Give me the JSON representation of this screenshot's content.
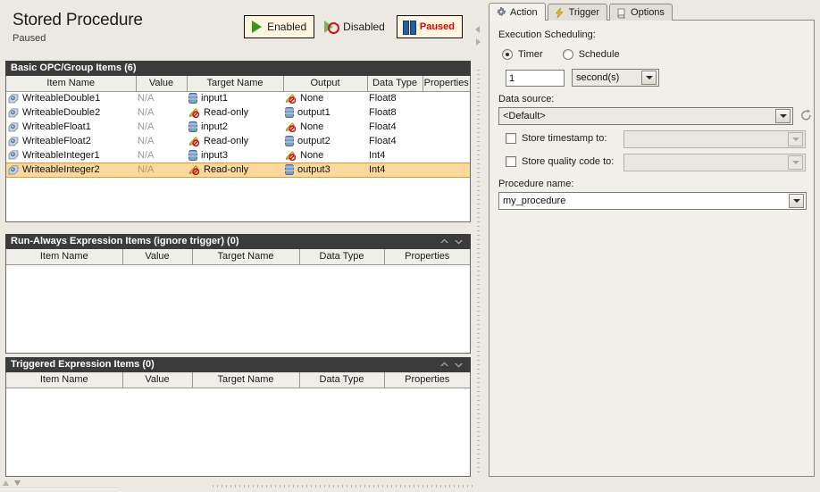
{
  "header": {
    "title": "Stored Procedure",
    "subtitle": "Paused",
    "buttons": [
      {
        "label": "Enabled",
        "icon": "play-icon",
        "framed": true
      },
      {
        "label": "Disabled",
        "icon": "play-disabled-icon",
        "framed": false
      },
      {
        "label": "Paused",
        "icon": "pause-icon",
        "framed": true
      }
    ]
  },
  "panels": {
    "basic": {
      "title": "Basic OPC/Group Items (6)",
      "columns": [
        "Item Name",
        "Value",
        "Target Name",
        "Output",
        "Data Type",
        "Properties"
      ],
      "rows": [
        {
          "name": "WriteableDouble1",
          "value": "N/A",
          "target": "input1",
          "target_icon": "database-icon",
          "output": "None",
          "output_icon": "read-only-icon",
          "datatype": "Float8",
          "properties": "",
          "selected": false
        },
        {
          "name": "WriteableDouble2",
          "value": "N/A",
          "target": "Read-only",
          "target_icon": "read-only-icon",
          "output": "output1",
          "output_icon": "database-icon",
          "datatype": "Float8",
          "properties": "",
          "selected": false
        },
        {
          "name": "WriteableFloat1",
          "value": "N/A",
          "target": "input2",
          "target_icon": "database-icon",
          "output": "None",
          "output_icon": "read-only-icon",
          "datatype": "Float4",
          "properties": "",
          "selected": false
        },
        {
          "name": "WriteableFloat2",
          "value": "N/A",
          "target": "Read-only",
          "target_icon": "read-only-icon",
          "output": "output2",
          "output_icon": "database-icon",
          "datatype": "Float4",
          "properties": "",
          "selected": false
        },
        {
          "name": "WriteableInteger1",
          "value": "N/A",
          "target": "input3",
          "target_icon": "database-icon",
          "output": "None",
          "output_icon": "read-only-icon",
          "datatype": "Int4",
          "properties": "",
          "selected": false
        },
        {
          "name": "WriteableInteger2",
          "value": "N/A",
          "target": "Read-only",
          "target_icon": "read-only-icon",
          "output": "output3",
          "output_icon": "database-icon",
          "datatype": "Int4",
          "properties": "",
          "selected": true
        }
      ]
    },
    "run_always": {
      "title": "Run-Always Expression Items (ignore trigger) (0)",
      "columns": [
        "Item Name",
        "Value",
        "Target Name",
        "Data Type",
        "Properties"
      ],
      "rows": []
    },
    "triggered": {
      "title": "Triggered Expression Items (0)",
      "columns": [
        "Item Name",
        "Value",
        "Target Name",
        "Data Type",
        "Properties"
      ],
      "rows": []
    }
  },
  "right": {
    "tabs": [
      {
        "label": "Action",
        "icon": "gear-icon",
        "active": true
      },
      {
        "label": "Trigger",
        "icon": "bolt-icon",
        "active": false
      },
      {
        "label": "Options",
        "icon": "scroll-icon",
        "active": false
      }
    ],
    "action": {
      "scheduling_label": "Execution Scheduling:",
      "radio_timer": "Timer",
      "radio_schedule": "Schedule",
      "interval_value": "1",
      "interval_unit": "second(s)",
      "data_source_label": "Data source:",
      "data_source_value": "<Default>",
      "store_timestamp_label": "Store timestamp to:",
      "store_timestamp_value": "",
      "store_quality_label": "Store quality code to:",
      "store_quality_value": "",
      "procedure_name_label": "Procedure name:",
      "procedure_name_value": "my_procedure"
    }
  },
  "colors": {
    "panel_header_bg": "#3b3b3b",
    "selected_row_bg": "#fbd89b",
    "paused_text": "#e00000",
    "window_bg": "#ece9e3"
  }
}
